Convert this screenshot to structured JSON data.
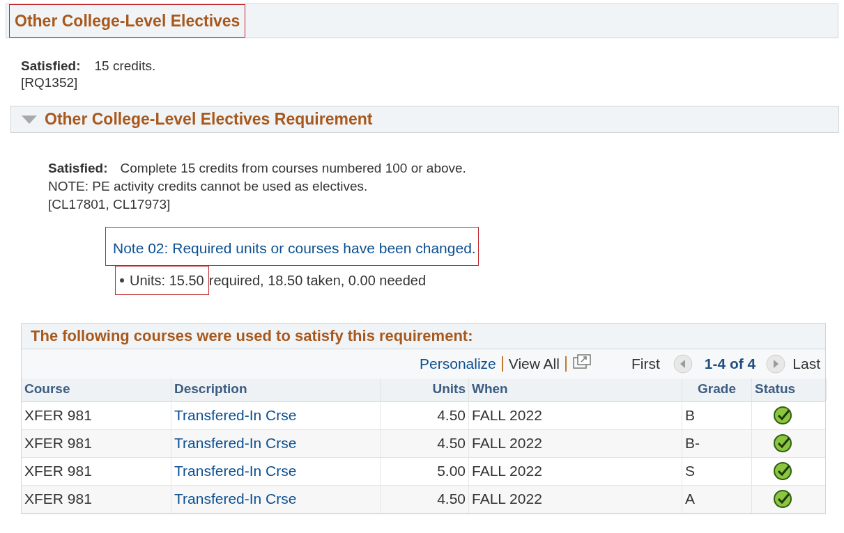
{
  "title": {
    "text": "Other College-Level Electives",
    "highlighted": true
  },
  "summary": {
    "status": "Satisfied:",
    "text": "15 credits.",
    "code": "[RQ1352]"
  },
  "requirement": {
    "title": "Other College-Level Electives Requirement",
    "expanded": true,
    "status": "Satisfied:",
    "lines": [
      "Complete 15 credits from courses numbered 100 or above.",
      "NOTE: PE activity credits cannot be used as electives.",
      "[CL17801, CL17973]"
    ],
    "note": {
      "text": "Note 02: Required units or courses have been changed.",
      "highlighted": true
    },
    "units": {
      "label": "Units: 15.50",
      "rest": "required, 18.50 taken, 0.00 needed",
      "highlighted": true
    }
  },
  "grid": {
    "title": "The following courses were used to satisfy this requirement:",
    "personalize": "Personalize",
    "view_all": "View All",
    "first": "First",
    "range": "1-4 of 4",
    "last": "Last",
    "columns": [
      "Course",
      "Description",
      "Units",
      "When",
      "Grade",
      "Status"
    ],
    "rows": [
      {
        "course": "XFER 981",
        "description": "Transfered-In Crse",
        "units": "4.50",
        "when": "FALL 2022",
        "grade": "B",
        "done": true
      },
      {
        "course": "XFER 981",
        "description": "Transfered-In Crse",
        "units": "4.50",
        "when": "FALL 2022",
        "grade": "B-",
        "done": true
      },
      {
        "course": "XFER 981",
        "description": "Transfered-In Crse",
        "units": "5.00",
        "when": "FALL 2022",
        "grade": "S",
        "done": true
      },
      {
        "course": "XFER 981",
        "description": "Transfered-In Crse",
        "units": "4.50",
        "when": "FALL 2022",
        "grade": "A",
        "done": true
      }
    ]
  }
}
